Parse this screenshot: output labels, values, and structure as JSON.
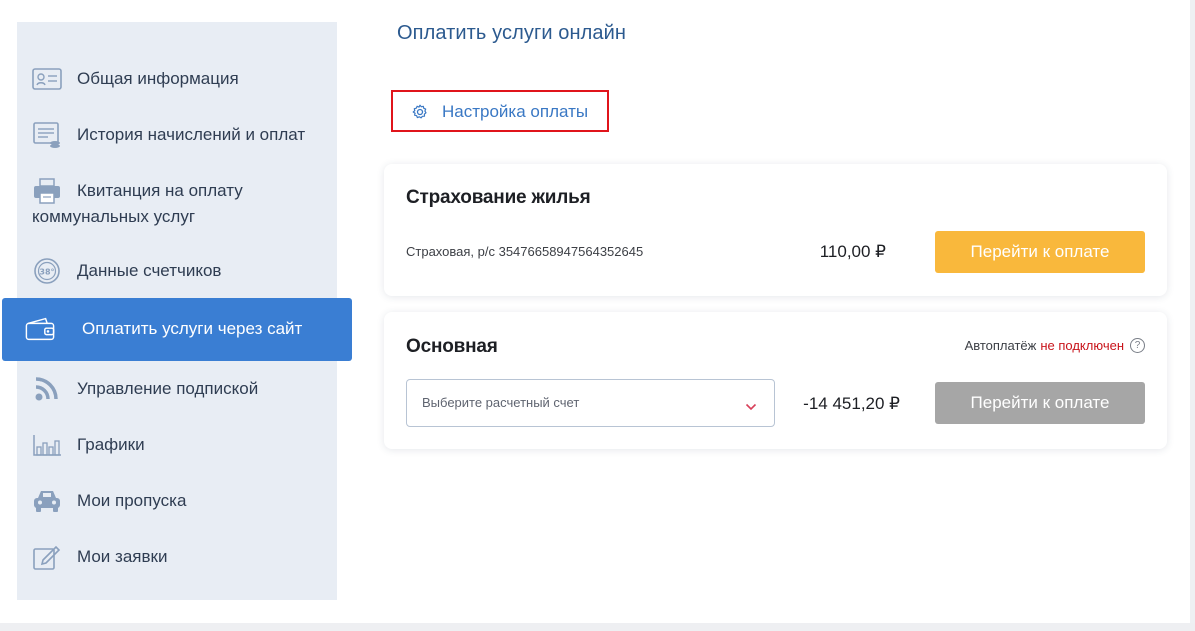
{
  "sidebar": {
    "items": [
      {
        "label": "Общая информация",
        "icon": "id-card-icon"
      },
      {
        "label": "История начислений и оплат",
        "icon": "invoice-history-icon"
      },
      {
        "label": "Квитанция на оплату коммунальных услуг",
        "icon": "printer-icon"
      },
      {
        "label": "Данные счетчиков",
        "icon": "meter-icon"
      },
      {
        "label": "Оплатить услуги через сайт",
        "icon": "wallet-icon",
        "active": true
      },
      {
        "label": "Управление подпиской",
        "icon": "rss-icon"
      },
      {
        "label": "Графики",
        "icon": "bar-chart-icon"
      },
      {
        "label": "Мои пропуска",
        "icon": "car-icon"
      },
      {
        "label": "Мои заявки",
        "icon": "edit-icon"
      }
    ]
  },
  "main": {
    "title": "Оплатить услуги онлайн",
    "settings_link": "Настройка оплаты",
    "cards": [
      {
        "title": "Страхование жилья",
        "account": "Страховая, р/с 35476658947564352645",
        "amount": "110,00 ₽",
        "button": "Перейти к оплате"
      },
      {
        "title": "Основная",
        "autopay_label": "Автоплатёж",
        "autopay_status": "не подключен",
        "select_placeholder": "Выберите расчетный счет",
        "amount": "-14 451,20 ₽",
        "button": "Перейти к оплате"
      }
    ]
  },
  "colors": {
    "accent": "#3a7ed3",
    "title": "#2c5a8f",
    "pay_button": "#f9b83c",
    "disabled_button": "#a6a6a6",
    "alert": "#c8141b",
    "highlight_box": "#e0141b"
  }
}
